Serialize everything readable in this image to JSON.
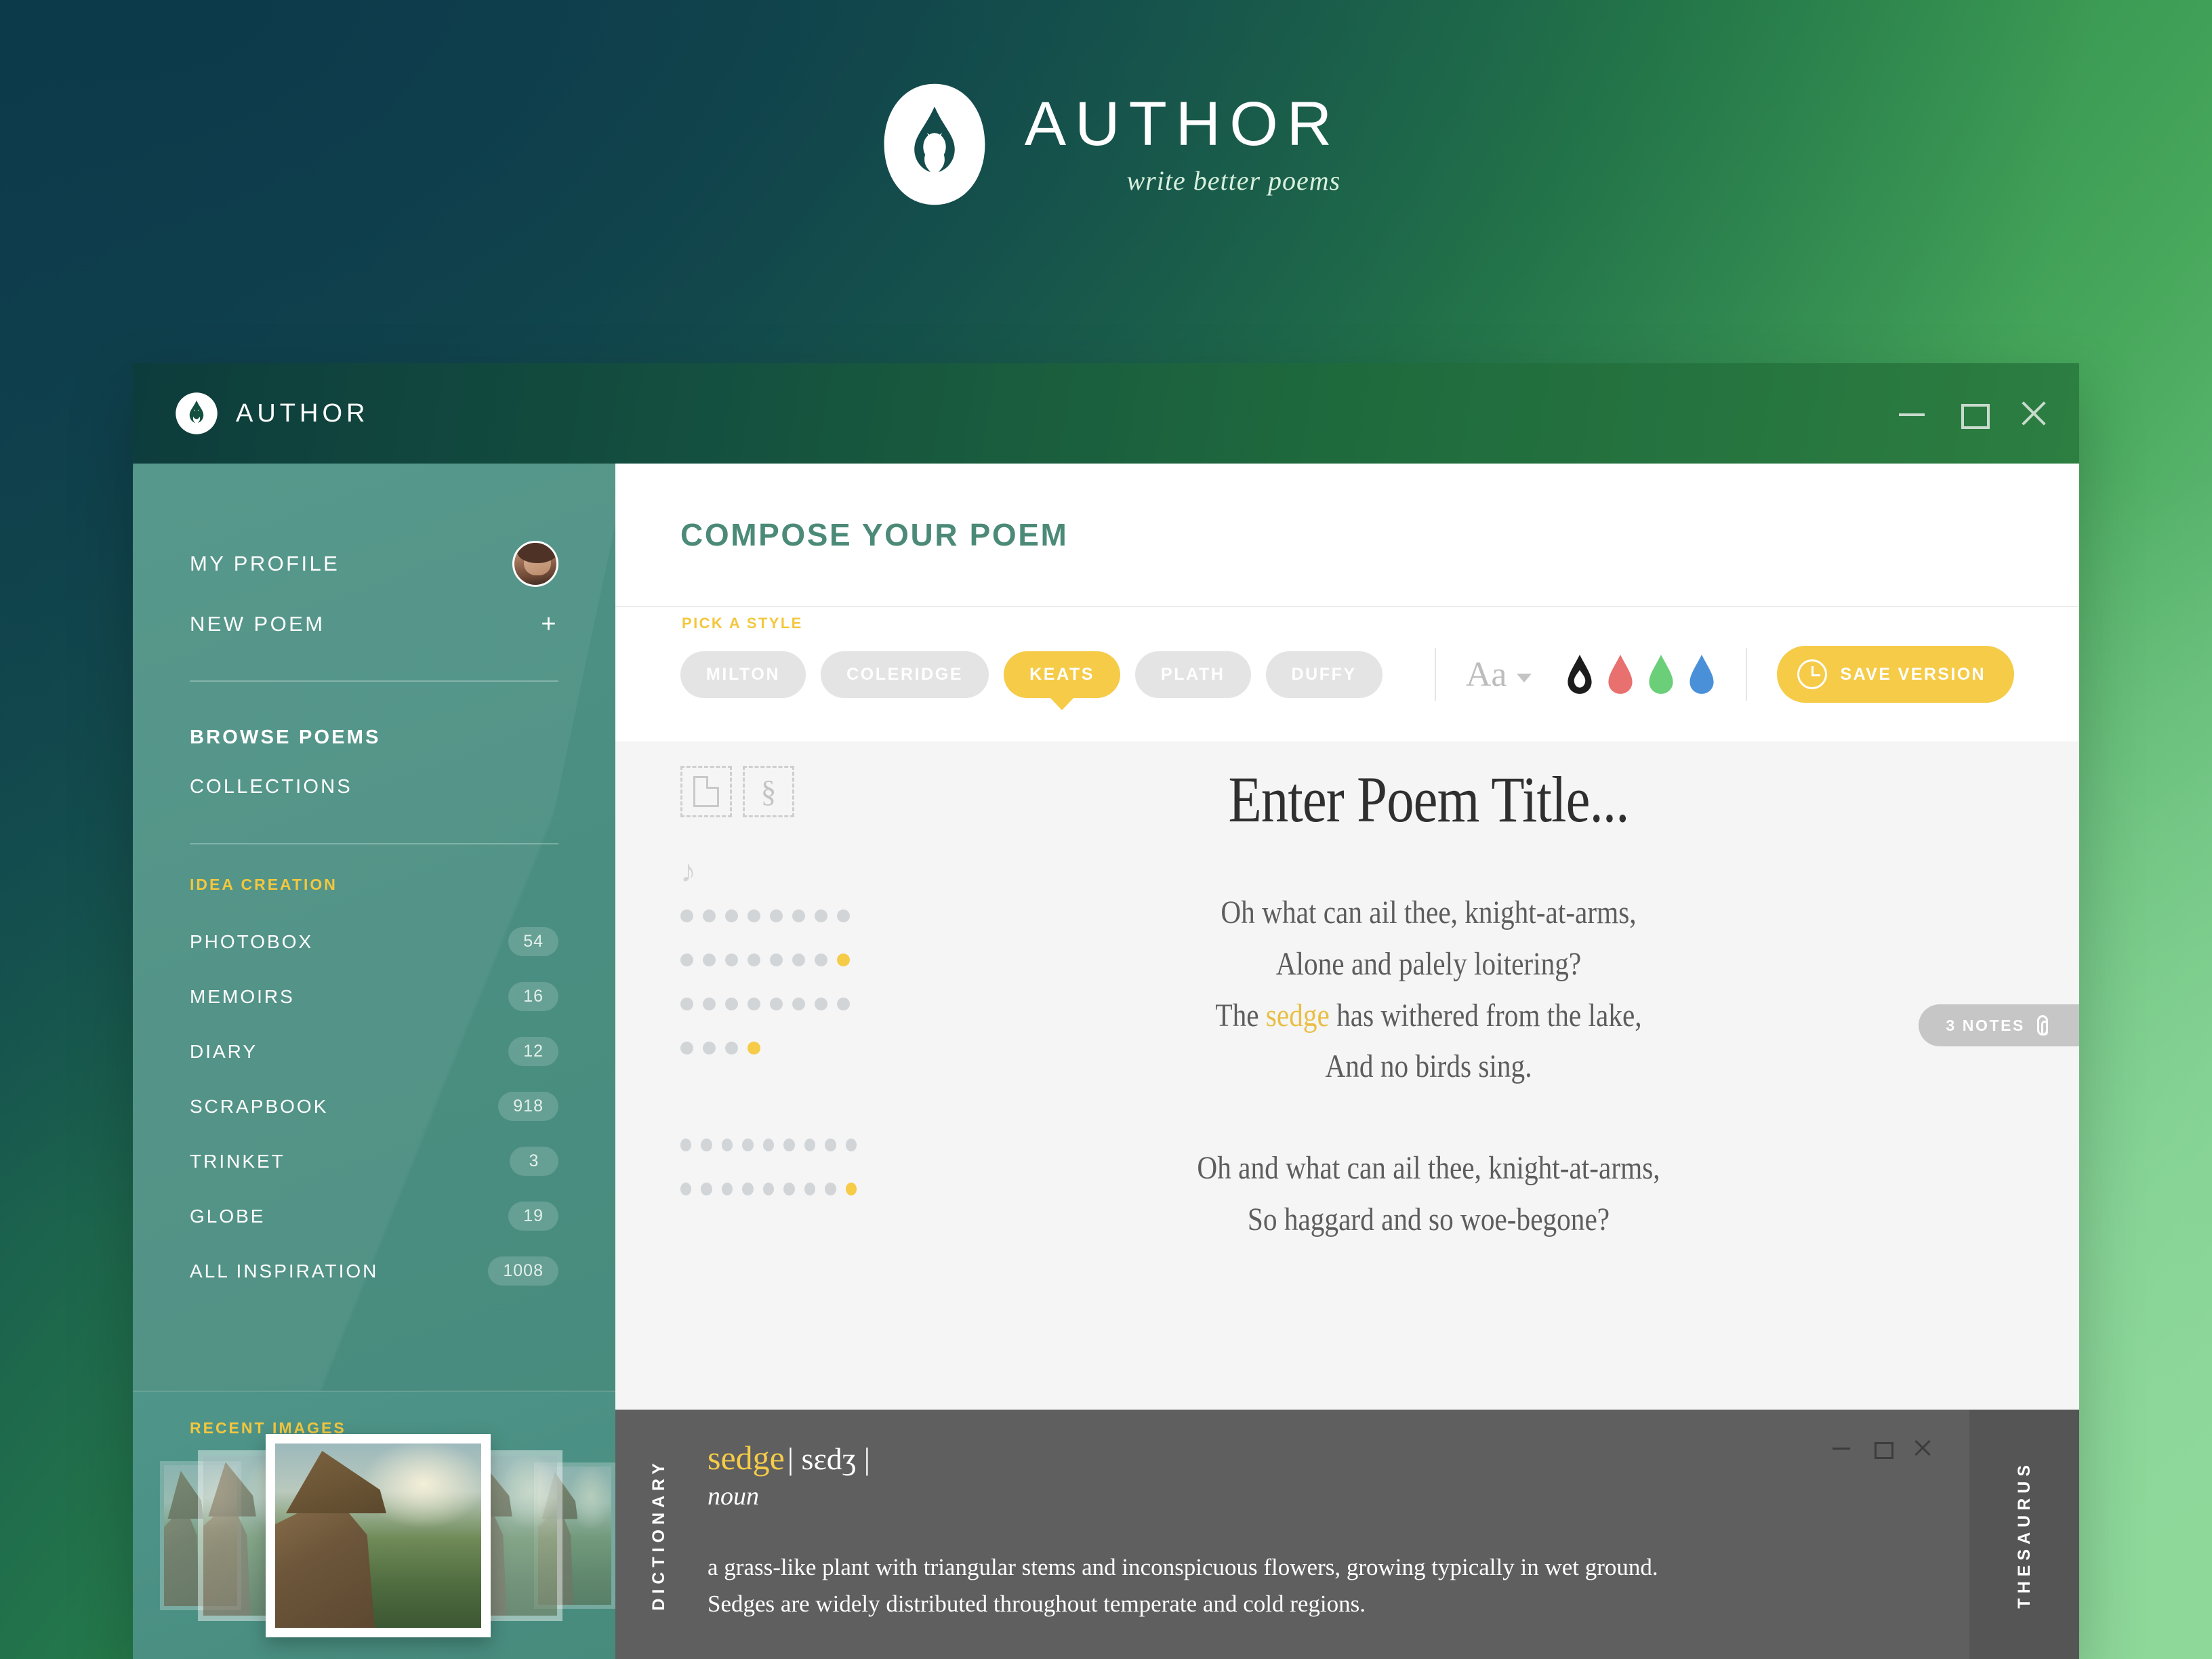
{
  "hero": {
    "brand": "AUTHOR",
    "tagline": "write better poems",
    "logo_icon": "flame-droplet-logo"
  },
  "window": {
    "titlebar": {
      "logo_icon": "flame-droplet-logo",
      "title": "AUTHOR",
      "minimize_label": "minimize",
      "maximize_label": "maximize",
      "close_label": "close"
    }
  },
  "sidebar": {
    "profile": {
      "label": "MY PROFILE",
      "avatar_icon": "user-avatar"
    },
    "new_poem": {
      "label": "NEW POEM",
      "action_icon": "plus-icon"
    },
    "nav": [
      {
        "label": "BROWSE POEMS"
      },
      {
        "label": "COLLECTIONS"
      }
    ],
    "idea_creation": {
      "heading": "IDEA CREATION",
      "items": [
        {
          "label": "PHOTOBOX",
          "count": "54"
        },
        {
          "label": "MEMOIRS",
          "count": "16"
        },
        {
          "label": "DIARY",
          "count": "12"
        },
        {
          "label": "SCRAPBOOK",
          "count": "918"
        },
        {
          "label": "TRINKET",
          "count": "3"
        },
        {
          "label": "GLOBE",
          "count": "19"
        },
        {
          "label": "ALL INSPIRATION",
          "count": "1008"
        }
      ]
    },
    "recent_images": {
      "heading": "RECENT IMAGES"
    }
  },
  "main": {
    "page_title": "COMPOSE YOUR POEM",
    "toolbar": {
      "pick_a_style_label": "PICK A STYLE",
      "styles": [
        {
          "label": "MILTON",
          "active": false
        },
        {
          "label": "COLERIDGE",
          "active": false
        },
        {
          "label": "KEATS",
          "active": true
        },
        {
          "label": "PLATH",
          "active": false
        },
        {
          "label": "DUFFY",
          "active": false
        }
      ],
      "font_picker_label": "Aa",
      "color_swatches": [
        {
          "name": "black-flame-swatch",
          "color": "#1c1c1c"
        },
        {
          "name": "red-flame-swatch",
          "color": "#e8706e"
        },
        {
          "name": "green-flame-swatch",
          "color": "#6bcf7a"
        },
        {
          "name": "blue-flame-swatch",
          "color": "#4a90d9"
        }
      ],
      "save_button": {
        "label": "SAVE VERSION",
        "icon": "clock-icon",
        "color": "#f5cb48"
      }
    },
    "gutter": {
      "placeholder_page_icon": "page-icon",
      "placeholder_section_icon": "section-icon",
      "music_icon": "music-note-icon",
      "dot_rows": [
        {
          "total": 8,
          "highlighted": 0
        },
        {
          "total": 8,
          "highlighted": 1
        },
        {
          "total": 8,
          "highlighted": 0
        },
        {
          "total": 4,
          "highlighted": 1
        },
        {
          "total": 9,
          "highlighted": 0
        },
        {
          "total": 9,
          "highlighted": 1
        }
      ]
    },
    "poem": {
      "title_placeholder": "Enter Poem Title...",
      "highlight_word": "sedge",
      "stanzas": [
        {
          "lines": [
            {
              "pre": "Oh what can ail thee, knight-at-arms,",
              "hl": "",
              "post": ""
            },
            {
              "pre": "Alone and palely loitering?",
              "hl": "",
              "post": ""
            },
            {
              "pre": "The ",
              "hl": "sedge",
              "post": " has withered from the lake,"
            },
            {
              "pre": "And no birds sing.",
              "hl": "",
              "post": ""
            }
          ]
        },
        {
          "lines": [
            {
              "pre": "Oh and what can ail thee, knight-at-arms,",
              "hl": "",
              "post": ""
            },
            {
              "pre": "So haggard and so woe-begone?",
              "hl": "",
              "post": ""
            }
          ]
        }
      ]
    },
    "notes_badge": {
      "label": "3 NOTES",
      "icon": "paperclip-icon"
    }
  },
  "dictionary": {
    "tab_label": "DICTIONARY",
    "word": "sedge",
    "ipa": "| sɛdʒ |",
    "part_of_speech": "noun",
    "definition": "a grass-like plant with triangular stems and inconspicuous flowers, growing typically in wet ground. Sedges are widely distributed throughout temperate and cold regions.",
    "minimize_label": "minimize",
    "maximize_label": "maximize",
    "close_label": "close"
  },
  "thesaurus": {
    "tab_label": "THESAURUS"
  }
}
